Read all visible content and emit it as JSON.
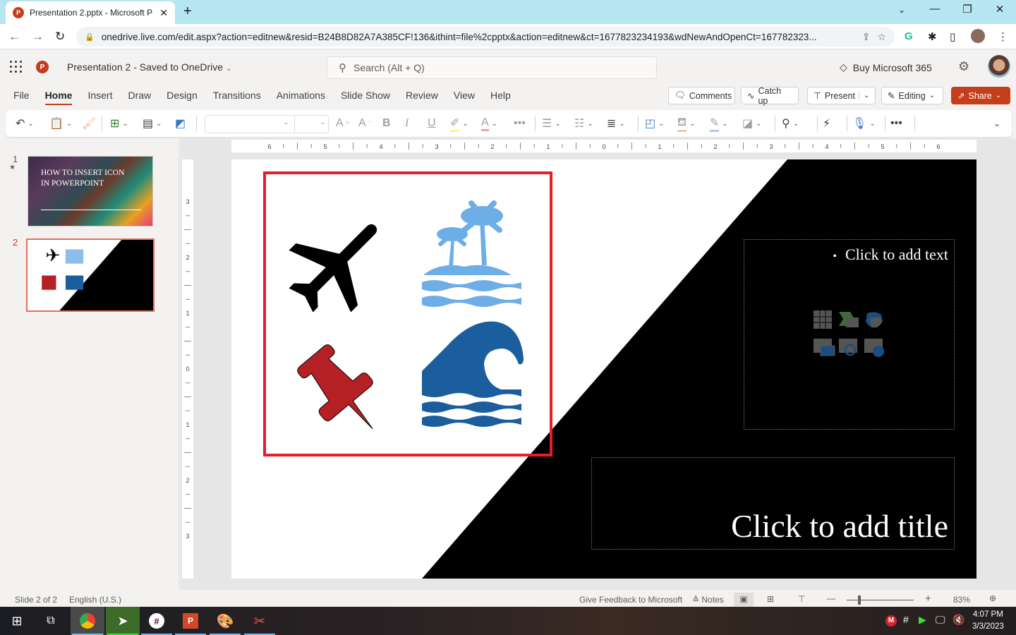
{
  "browser": {
    "tab_title": "Presentation 2.pptx - Microsoft P",
    "url": "onedrive.live.com/edit.aspx?action=editnew&resid=B24B8D82A7A385CF!136&ithint=file%2cpptx&action=editnew&ct=1677823234193&wdNewAndOpenCt=167782323..."
  },
  "header": {
    "doc_title": "Presentation 2",
    "save_status": "Saved to OneDrive",
    "search_placeholder": "Search (Alt + Q)",
    "buy_label": "Buy Microsoft 365"
  },
  "ribbon": {
    "tabs": [
      "File",
      "Home",
      "Insert",
      "Draw",
      "Design",
      "Transitions",
      "Animations",
      "Slide Show",
      "Review",
      "View",
      "Help"
    ],
    "active_tab": "Home",
    "comments": "Comments",
    "catch_up": "Catch up",
    "present": "Present",
    "editing": "Editing",
    "share": "Share"
  },
  "thumbnails": [
    {
      "number": "1",
      "title": "HOW TO INSERT ICON IN POWERPOINT"
    },
    {
      "number": "2",
      "selected": true
    }
  ],
  "ruler": {
    "horizontal": [
      "6",
      "5",
      "4",
      "3",
      "2",
      "1",
      "0",
      "1",
      "2",
      "3",
      "4",
      "5",
      "6"
    ],
    "vertical": [
      "3",
      "2",
      "1",
      "0",
      "1",
      "2",
      "3"
    ]
  },
  "slide": {
    "body_placeholder": "Click to add text",
    "title_placeholder": "Click to add title",
    "icons": [
      "airplane",
      "island-palm-trees",
      "pushpin",
      "wave"
    ],
    "colors": {
      "airplane": "#000000",
      "island": "#6eaee6",
      "pushpin": "#b52025",
      "wave": "#1b5e9e",
      "selection": "#e61e25"
    }
  },
  "status": {
    "slide_info": "Slide 2 of 2",
    "language": "English (U.S.)",
    "feedback": "Give Feedback to Microsoft",
    "notes": "Notes",
    "zoom": "83%"
  },
  "taskbar": {
    "time": "4:07 PM",
    "date": "3/3/2023"
  }
}
